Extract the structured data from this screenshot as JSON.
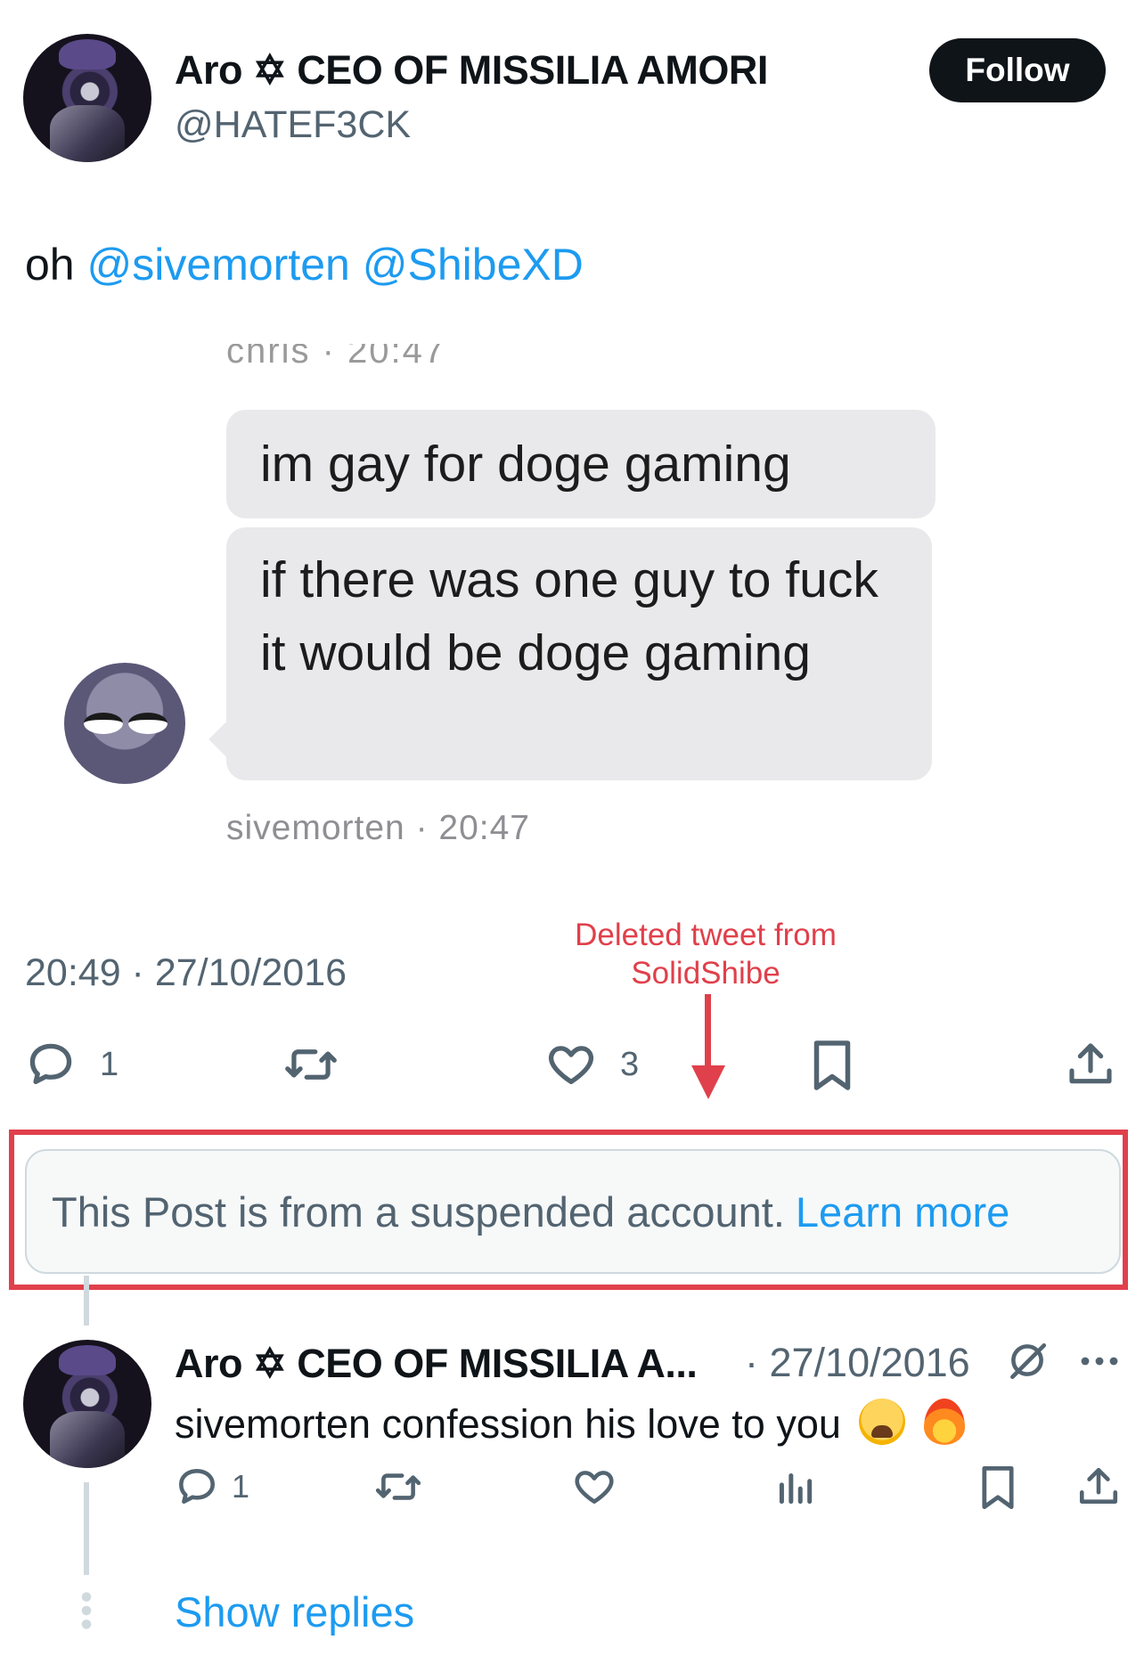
{
  "header": {
    "display_name": "Aro ✡ CEO OF MISSILIA AMORI",
    "handle": "@HATEF3CK",
    "follow_label": "Follow"
  },
  "tweet": {
    "text_prefix": "oh",
    "mentions": [
      "@sivemorten",
      "@ShibeXD"
    ],
    "timestamp": "20:49 · 27/10/2016",
    "embedded_image": {
      "cut_header": "chris · 20:47",
      "messages": [
        "im gay for doge gaming",
        "if there was one guy to fuck it would be doge gaming"
      ],
      "meta": "sivemorten · 20:47"
    },
    "actions": {
      "reply_count": "1",
      "like_count": "3"
    }
  },
  "annotation": {
    "text": "Deleted tweet from SolidShibe",
    "color": "#e0404b"
  },
  "suspended": {
    "message": "This Post is from a suspended account.",
    "link": "Learn more"
  },
  "reply": {
    "display_name": "Aro ✡ CEO OF MISSILIA A...",
    "date": "· 27/10/2016",
    "text": "sivemorten confession his love to you",
    "emojis": [
      "weary-face",
      "fire"
    ],
    "reply_count": "1"
  },
  "show_replies": "Show replies",
  "colors": {
    "accent": "#1d9bf0",
    "text": "#0f1419",
    "secondary": "#536471"
  }
}
